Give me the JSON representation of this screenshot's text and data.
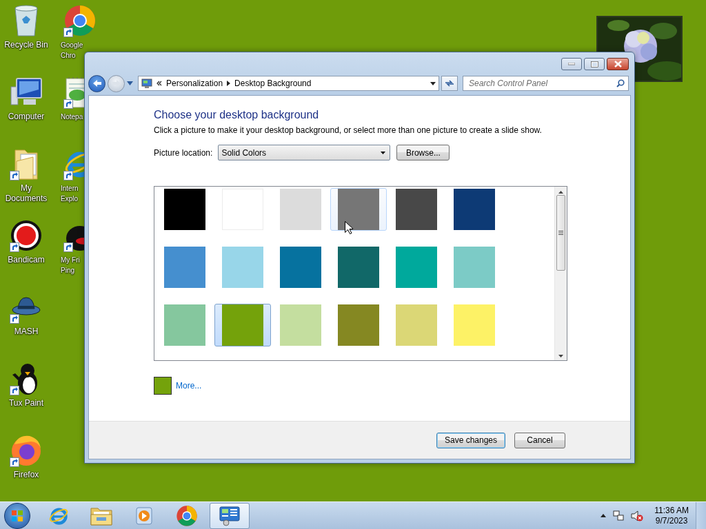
{
  "desktop": {
    "icons": [
      {
        "label": "Recycle Bin",
        "shortcut": false,
        "cut": false
      },
      {
        "label": "Computer",
        "shortcut": false,
        "cut": false
      },
      {
        "label": "My Documents",
        "shortcut": true,
        "cut": false
      },
      {
        "label": "Bandicam",
        "shortcut": true,
        "cut": false
      },
      {
        "label": "MASH",
        "shortcut": true,
        "cut": false
      },
      {
        "label": "Tux Paint",
        "shortcut": true,
        "cut": false
      },
      {
        "label": "Firefox",
        "shortcut": true,
        "cut": false
      },
      {
        "label": "Google Chro",
        "shortcut": true,
        "cut": true
      },
      {
        "label": "Notepa",
        "shortcut": true,
        "cut": true
      },
      {
        "label": "Intern Explo",
        "shortcut": true,
        "cut": true
      },
      {
        "label": "My Fri Ping",
        "shortcut": true,
        "cut": true
      }
    ]
  },
  "window": {
    "address": {
      "crumbs": [
        "Personalization",
        "Desktop Background"
      ]
    },
    "search": {
      "placeholder": "Search Control Panel"
    },
    "heading": "Choose your desktop background",
    "description": "Click a picture to make it your desktop background, or select more than one picture to create a slide show.",
    "picture_location": {
      "label": "Picture location:",
      "value": "Solid Colors"
    },
    "browse": "Browse...",
    "swatches": [
      {
        "color": "#000000",
        "selected": false,
        "hovered": false
      },
      {
        "color": "#ffffff",
        "selected": false,
        "hovered": false
      },
      {
        "color": "#dcdcdc",
        "selected": false,
        "hovered": false
      },
      {
        "color": "#767676",
        "selected": false,
        "hovered": true
      },
      {
        "color": "#484848",
        "selected": false,
        "hovered": false
      },
      {
        "color": "#0d3a75",
        "selected": false,
        "hovered": false
      },
      {
        "color": "#458fcf",
        "selected": false,
        "hovered": false
      },
      {
        "color": "#98d6e9",
        "selected": false,
        "hovered": false
      },
      {
        "color": "#06729f",
        "selected": false,
        "hovered": false
      },
      {
        "color": "#116868",
        "selected": false,
        "hovered": false
      },
      {
        "color": "#00a99c",
        "selected": false,
        "hovered": false
      },
      {
        "color": "#7ccbc6",
        "selected": false,
        "hovered": false
      },
      {
        "color": "#85c79e",
        "selected": false,
        "hovered": false
      },
      {
        "color": "#74a20b",
        "selected": true,
        "hovered": false
      },
      {
        "color": "#c4de9f",
        "selected": false,
        "hovered": false
      },
      {
        "color": "#858822",
        "selected": false,
        "hovered": false
      },
      {
        "color": "#dbd776",
        "selected": false,
        "hovered": false
      },
      {
        "color": "#fdf266",
        "selected": false,
        "hovered": false
      }
    ],
    "more": {
      "label": "More...",
      "color": "#74a20b"
    },
    "buttons": [
      {
        "label": "Save changes",
        "default": true
      },
      {
        "label": "Cancel",
        "default": false
      }
    ]
  },
  "taskbar": {
    "apps": [
      {
        "active": false
      },
      {
        "active": false
      },
      {
        "active": false
      },
      {
        "active": false
      },
      {
        "active": true
      }
    ],
    "clock": {
      "time": "11:36 AM",
      "date": "9/7/2023"
    }
  }
}
